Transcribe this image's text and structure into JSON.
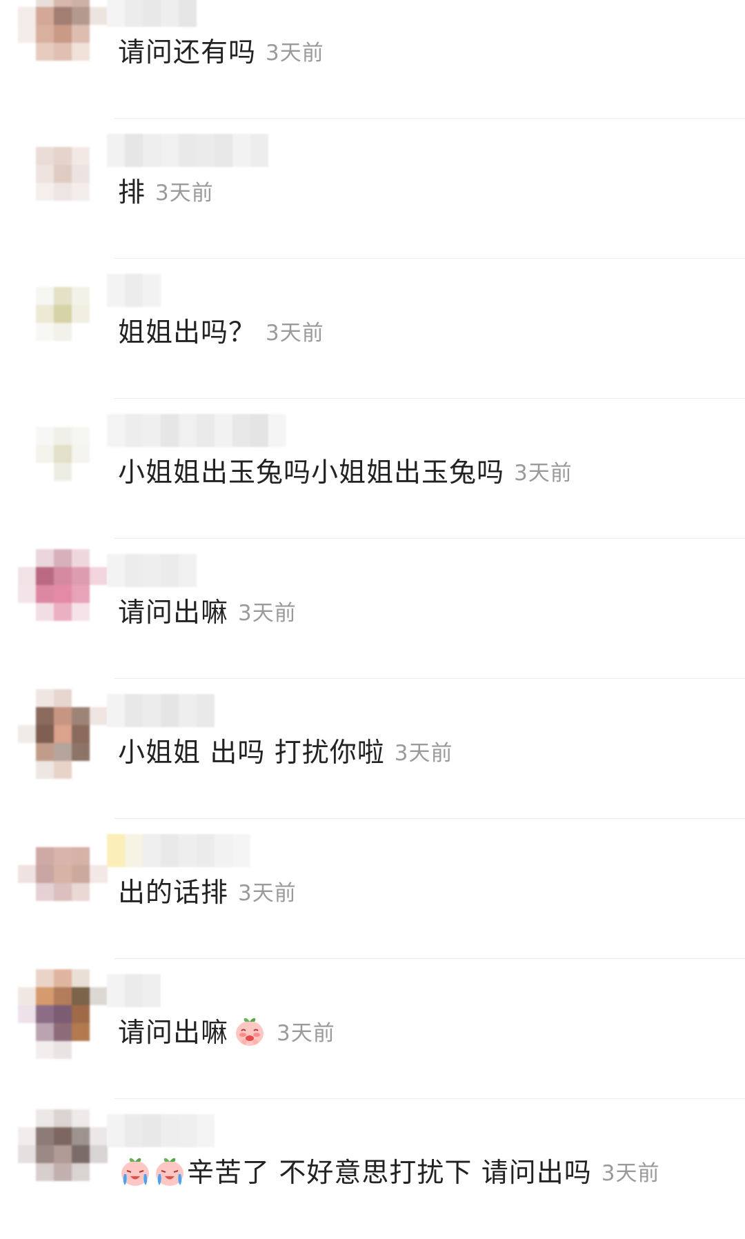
{
  "comments": [
    {
      "text": "请问还有吗",
      "time": "3天前"
    },
    {
      "text": "排",
      "time": "3天前"
    },
    {
      "text": "姐姐出吗？",
      "time": "3天前"
    },
    {
      "text": "小姐姐出玉兔吗小姐姐出玉兔吗",
      "time": "3天前"
    },
    {
      "text": "请问出嘛",
      "time": "3天前"
    },
    {
      "text": "小姐姐 出吗 打扰你啦",
      "time": "3天前"
    },
    {
      "text": "出的话排",
      "time": "3天前"
    },
    {
      "text": "请问出嘛",
      "time": "3天前",
      "emoji": "shy-peach-emoji-icon"
    },
    {
      "text": "辛苦了 不好意思打扰下 请问出吗",
      "time": "3天前",
      "emoji_prefix": [
        "crying-peach-emoji-icon",
        "crying-peach-emoji-icon"
      ]
    }
  ],
  "colors": {
    "text": "#222222",
    "time": "#9a9a9a",
    "divider": "#ececec"
  }
}
